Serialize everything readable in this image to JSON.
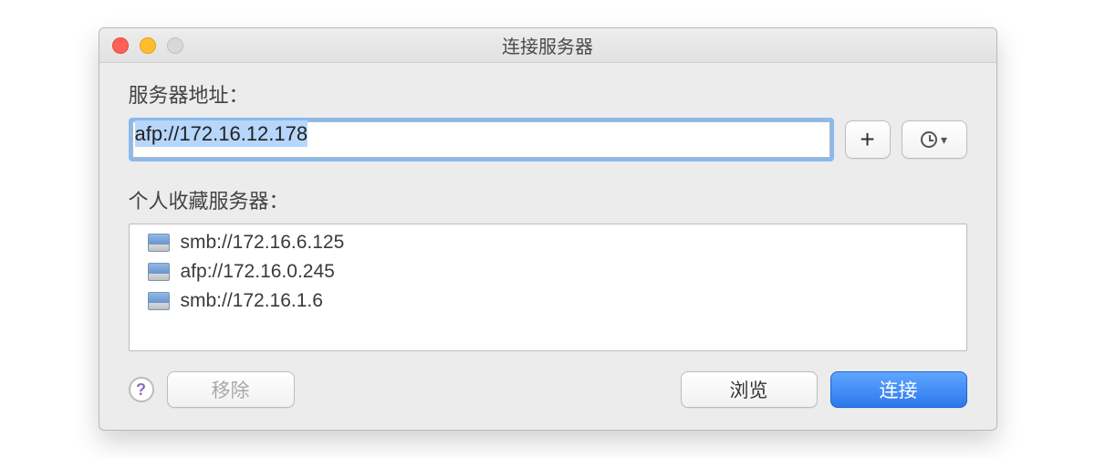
{
  "window": {
    "title": "连接服务器"
  },
  "address": {
    "label": "服务器地址：",
    "value": "afp://172.16.12.178"
  },
  "buttons": {
    "add": "+",
    "history_icon": "clock-icon"
  },
  "favorites": {
    "label": "个人收藏服务器：",
    "items": [
      {
        "url": "smb://172.16.6.125"
      },
      {
        "url": "afp://172.16.0.245"
      },
      {
        "url": "smb://172.16.1.6"
      }
    ]
  },
  "footer": {
    "remove": "移除",
    "browse": "浏览",
    "connect": "连接"
  }
}
